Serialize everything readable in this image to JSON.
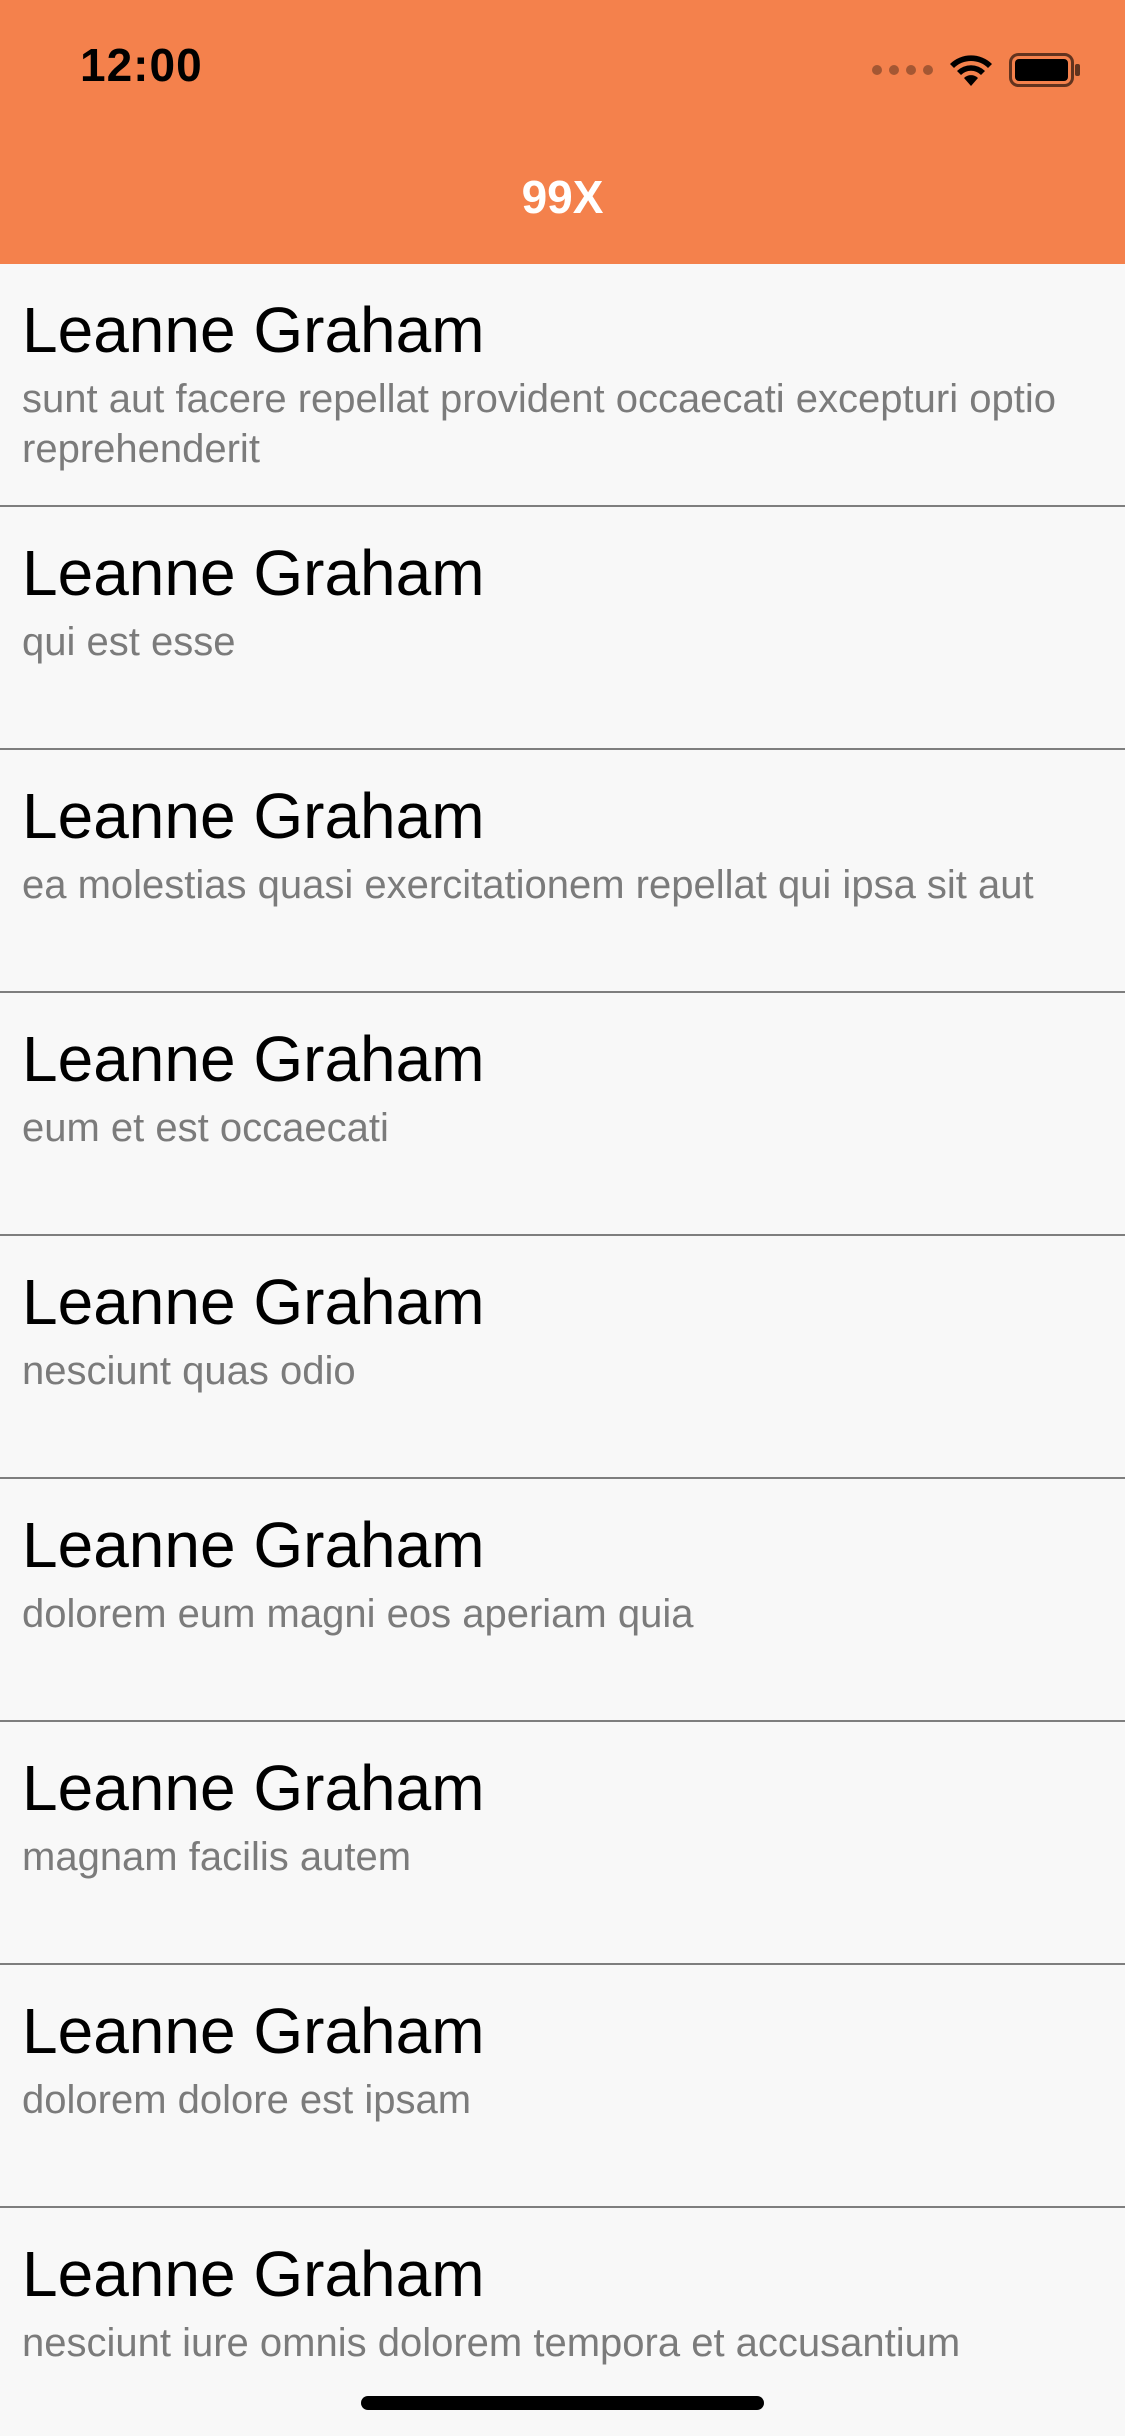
{
  "status_bar": {
    "time": "12:00",
    "icons": [
      "cellular-signal-icon",
      "wifi-icon",
      "battery-icon"
    ]
  },
  "header": {
    "title": "99X"
  },
  "colors": {
    "header_bg": "#f4814c",
    "list_bg": "#f8f8f8",
    "divider": "#7e7e7e",
    "subtitle": "#7b7b7b"
  },
  "list": {
    "items": [
      {
        "title": "Leanne Graham",
        "subtitle": "sunt aut facere repellat provident occaecati excepturi optio reprehenderit"
      },
      {
        "title": "Leanne Graham",
        "subtitle": "qui est esse"
      },
      {
        "title": "Leanne Graham",
        "subtitle": "ea molestias quasi exercitationem repellat qui ipsa sit aut"
      },
      {
        "title": "Leanne Graham",
        "subtitle": "eum et est occaecati"
      },
      {
        "title": "Leanne Graham",
        "subtitle": "nesciunt quas odio"
      },
      {
        "title": "Leanne Graham",
        "subtitle": "dolorem eum magni eos aperiam quia"
      },
      {
        "title": "Leanne Graham",
        "subtitle": "magnam facilis autem"
      },
      {
        "title": "Leanne Graham",
        "subtitle": "dolorem dolore est ipsam"
      },
      {
        "title": "Leanne Graham",
        "subtitle": "nesciunt iure omnis dolorem tempora et accusantium"
      }
    ]
  }
}
